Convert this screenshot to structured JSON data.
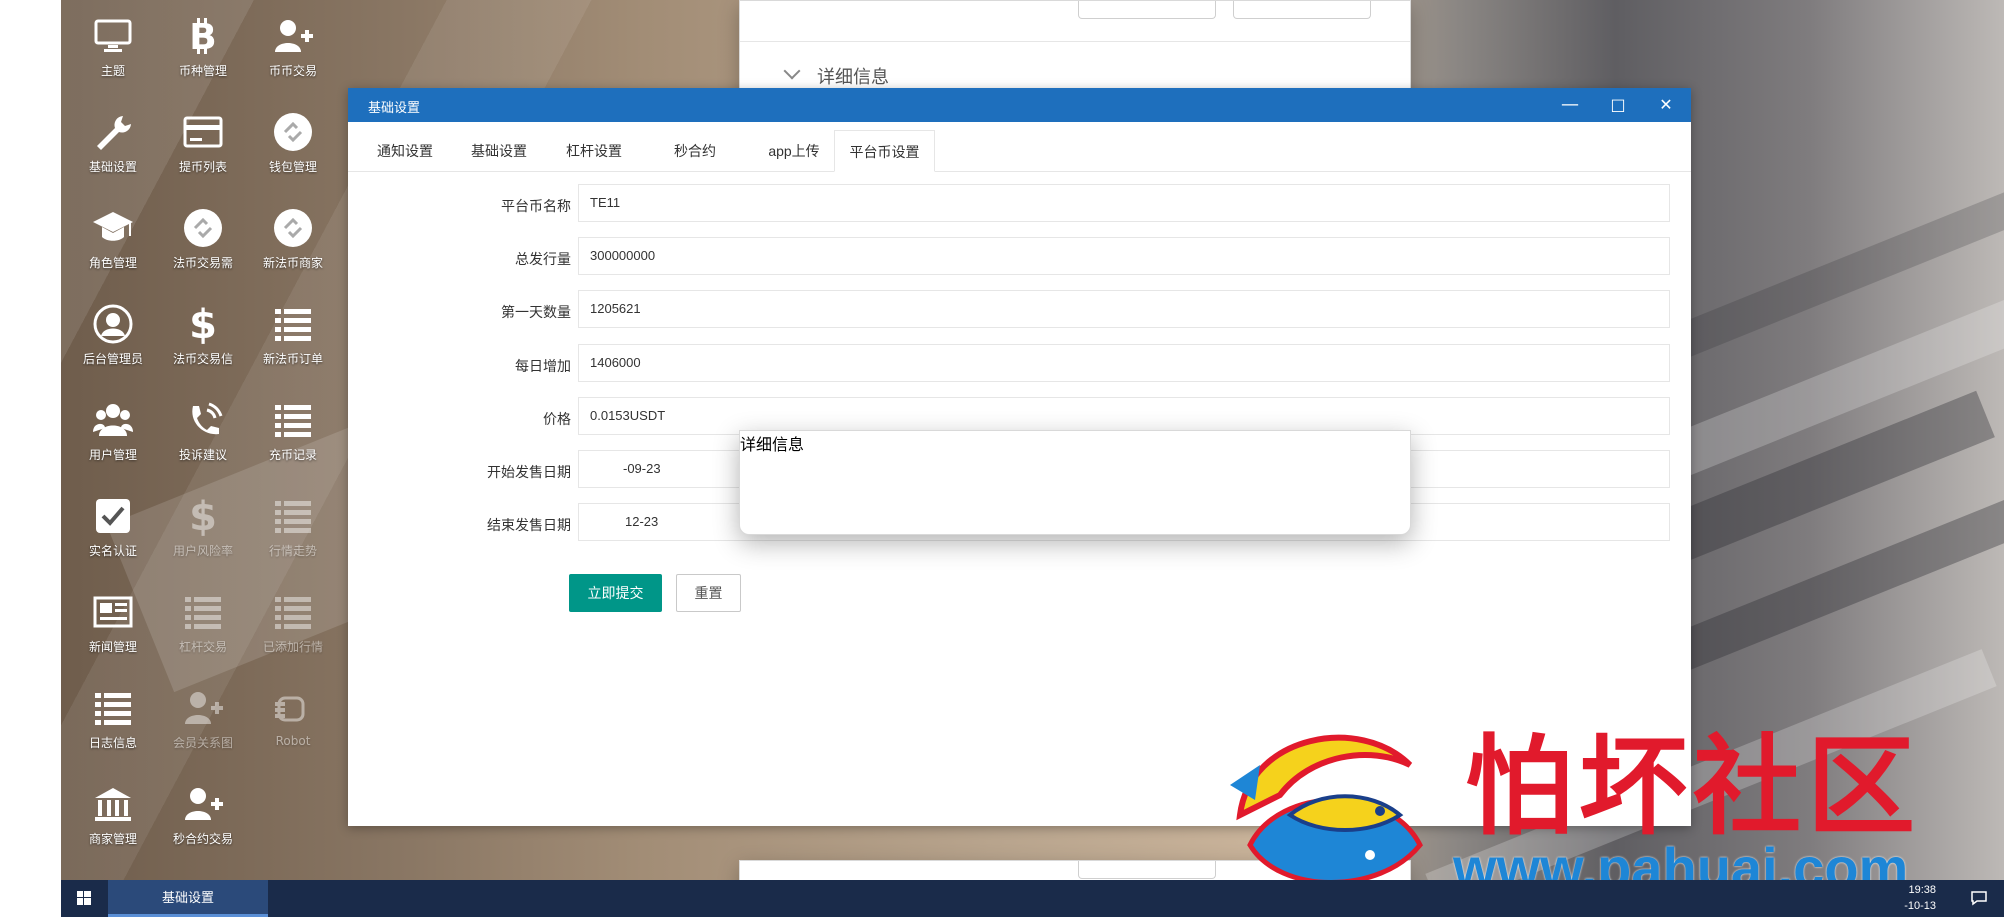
{
  "desktop": {
    "icons": [
      {
        "label": "主题",
        "icon": "monitor-icon"
      },
      {
        "label": "币种管理",
        "icon": "bitcoin-icon"
      },
      {
        "label": "币币交易",
        "icon": "add-user-icon"
      },
      {
        "label": "基础设置",
        "icon": "wrench-icon"
      },
      {
        "label": "提币列表",
        "icon": "card-icon"
      },
      {
        "label": "钱包管理",
        "icon": "link-icon"
      },
      {
        "label": "角色管理",
        "icon": "graduation-cap-icon"
      },
      {
        "label": "法币交易需",
        "icon": "link-icon"
      },
      {
        "label": "新法币商家",
        "icon": "link-icon"
      },
      {
        "label": "后台管理员",
        "icon": "user-circle-icon"
      },
      {
        "label": "法币交易信",
        "icon": "dollar-icon"
      },
      {
        "label": "新法币订单",
        "icon": "list-icon"
      },
      {
        "label": "用户管理",
        "icon": "users-icon"
      },
      {
        "label": "投诉建议",
        "icon": "phone-icon"
      },
      {
        "label": "充币记录",
        "icon": "list-icon"
      },
      {
        "label": "实名认证",
        "icon": "checkbox-icon"
      },
      {
        "label": "用户风险率",
        "icon": "dollar-icon"
      },
      {
        "label": "行情走势",
        "icon": "list-icon"
      },
      {
        "label": "新闻管理",
        "icon": "newspaper-icon"
      },
      {
        "label": "杠杆交易",
        "icon": "list-icon"
      },
      {
        "label": "已添加行情",
        "icon": "list-icon"
      },
      {
        "label": "日志信息",
        "icon": "list-icon"
      },
      {
        "label": "会员关系图",
        "icon": "add-user-icon"
      },
      {
        "label": "Robot",
        "icon": "hand-icon"
      },
      {
        "label": "商家管理",
        "icon": "bank-icon"
      },
      {
        "label": "秒合约交易",
        "icon": "add-user-icon"
      }
    ]
  },
  "background_windows": {
    "detail_label": "详细信息"
  },
  "window": {
    "title": "基础设置",
    "minimize": "—",
    "maximize": "□",
    "close": "✕",
    "tabs": [
      "通知设置",
      "基础设置",
      "杠杆设置",
      "秒合约",
      "app上传",
      "平台币设置"
    ],
    "active_tab": "平台币设置",
    "form": [
      {
        "label": "平台币名称",
        "value": "TE11"
      },
      {
        "label": "总发行量",
        "value": "300000000"
      },
      {
        "label": "第一天数量",
        "value": "1205621"
      },
      {
        "label": "每日增加",
        "value": "1406000"
      },
      {
        "label": "价格",
        "value": "0.0153USDT"
      },
      {
        "label": "开始发售日期",
        "value": "-09-23"
      },
      {
        "label": "结束发售日期",
        "value": "12-23"
      }
    ],
    "submit_label": "立即提交",
    "reset_label": "重置"
  },
  "taskbar": {
    "task_label": "基础设置",
    "time": "19:38",
    "date": "-10-13"
  },
  "watermark": {
    "text": "怕坏社区",
    "url": "www.pahuai.com"
  },
  "colors": {
    "titlebar": "#1e6fbd",
    "primary_button": "#009688",
    "watermark_red": "#e11a2c",
    "watermark_blue": "#1e86d6",
    "taskbar": "#1a2b4a"
  }
}
